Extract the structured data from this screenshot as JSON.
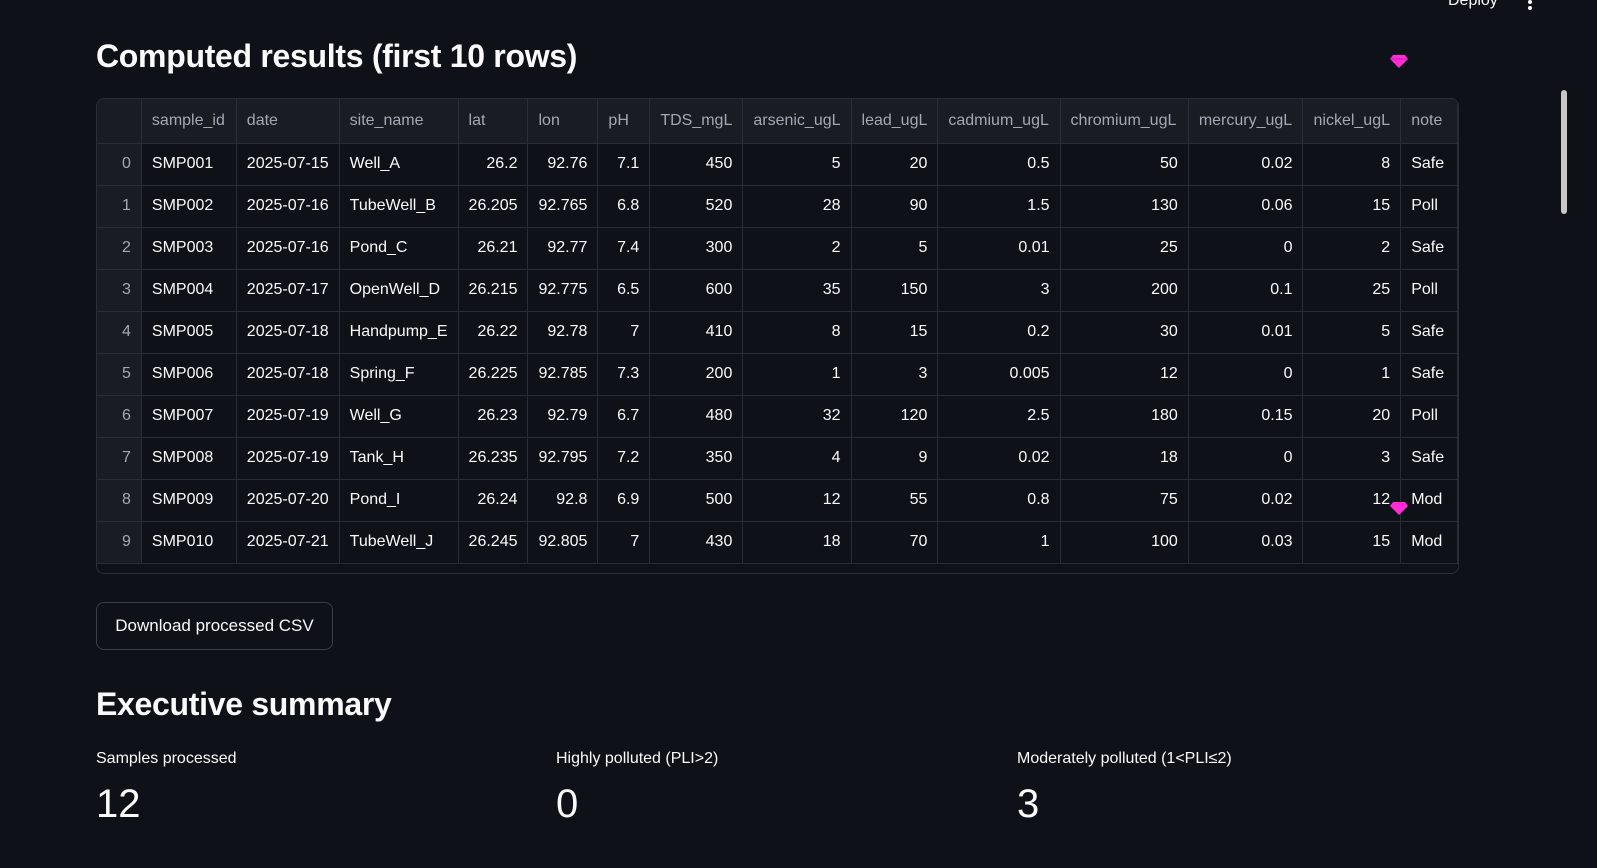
{
  "header": {
    "deploy_label": "Deploy",
    "menu_icon": "kebab-menu-icon"
  },
  "results": {
    "title": "Computed results (first 10 rows)",
    "columns": [
      "",
      "sample_id",
      "date",
      "site_name",
      "lat",
      "lon",
      "pH",
      "TDS_mgL",
      "arsenic_ugL",
      "lead_ugL",
      "cadmium_ugL",
      "chromium_ugL",
      "mercury_ugL",
      "nickel_ugL",
      "note"
    ],
    "rows": [
      [
        "0",
        "SMP001",
        "2025-07-15",
        "Well_A",
        "26.2",
        "92.76",
        "7.1",
        "450",
        "5",
        "20",
        "0.5",
        "50",
        "0.02",
        "8",
        "Safe"
      ],
      [
        "1",
        "SMP002",
        "2025-07-16",
        "TubeWell_B",
        "26.205",
        "92.765",
        "6.8",
        "520",
        "28",
        "90",
        "1.5",
        "130",
        "0.06",
        "15",
        "Poll"
      ],
      [
        "2",
        "SMP003",
        "2025-07-16",
        "Pond_C",
        "26.21",
        "92.77",
        "7.4",
        "300",
        "2",
        "5",
        "0.01",
        "25",
        "0",
        "2",
        "Safe"
      ],
      [
        "3",
        "SMP004",
        "2025-07-17",
        "OpenWell_D",
        "26.215",
        "92.775",
        "6.5",
        "600",
        "35",
        "150",
        "3",
        "200",
        "0.1",
        "25",
        "Poll"
      ],
      [
        "4",
        "SMP005",
        "2025-07-18",
        "Handpump_E",
        "26.22",
        "92.78",
        "7",
        "410",
        "8",
        "15",
        "0.2",
        "30",
        "0.01",
        "5",
        "Safe"
      ],
      [
        "5",
        "SMP006",
        "2025-07-18",
        "Spring_F",
        "26.225",
        "92.785",
        "7.3",
        "200",
        "1",
        "3",
        "0.005",
        "12",
        "0",
        "1",
        "Safe"
      ],
      [
        "6",
        "SMP007",
        "2025-07-19",
        "Well_G",
        "26.23",
        "92.79",
        "6.7",
        "480",
        "32",
        "120",
        "2.5",
        "180",
        "0.15",
        "20",
        "Poll"
      ],
      [
        "7",
        "SMP008",
        "2025-07-19",
        "Tank_H",
        "26.235",
        "92.795",
        "7.2",
        "350",
        "4",
        "9",
        "0.02",
        "18",
        "0",
        "3",
        "Safe"
      ],
      [
        "8",
        "SMP009",
        "2025-07-20",
        "Pond_I",
        "26.24",
        "92.8",
        "6.9",
        "500",
        "12",
        "55",
        "0.8",
        "75",
        "0.02",
        "12",
        "Mod"
      ],
      [
        "9",
        "SMP010",
        "2025-07-21",
        "TubeWell_J",
        "26.245",
        "92.805",
        "7",
        "430",
        "18",
        "70",
        "1",
        "100",
        "0.03",
        "15",
        "Mod"
      ]
    ]
  },
  "download": {
    "label": "Download processed CSV"
  },
  "summary": {
    "title": "Executive summary",
    "metrics": [
      {
        "label": "Samples processed",
        "value": "12"
      },
      {
        "label": "Highly polluted (PLI>2)",
        "value": "0"
      },
      {
        "label": "Moderately polluted (1<PLI≤2)",
        "value": "3"
      }
    ]
  },
  "colors": {
    "background": "#0e1117",
    "text": "#fafafa",
    "muted": "#a3a8b4",
    "accent_gem": "#ff2bd6"
  }
}
